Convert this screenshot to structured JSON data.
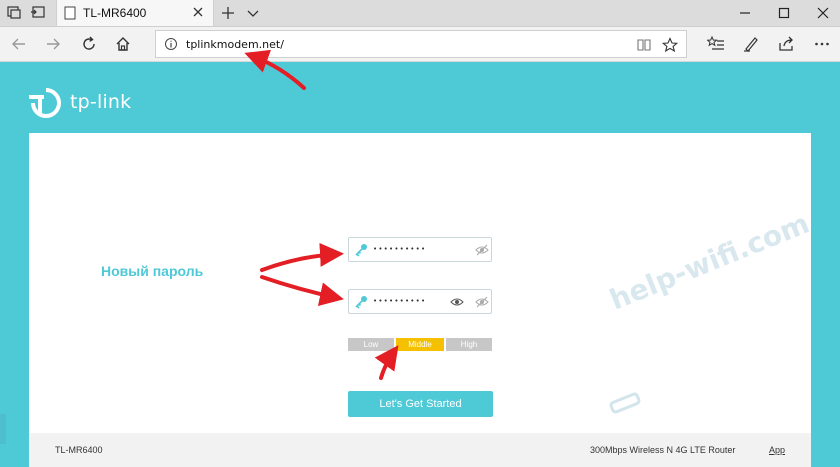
{
  "browser": {
    "tab_title": "TL-MR6400",
    "address_url": "tplinkmodem.net/"
  },
  "brand": {
    "logo_text": "tp-link",
    "accent_color": "#4ec9d6",
    "strength_active_color": "#f5c000"
  },
  "form": {
    "password_dots": "••••••••••",
    "confirm_dots": "••••••••••",
    "strength": {
      "low": "Low",
      "middle": "Middle",
      "high": "High",
      "selected": "middle"
    },
    "start_button": "Let's Get Started"
  },
  "annotation": {
    "label": "Новый пароль"
  },
  "footer": {
    "model": "TL-MR6400",
    "description": "300Mbps Wireless N 4G LTE Router",
    "app_link": "App"
  },
  "watermark": {
    "text": "help-wifi.com"
  },
  "icons": {
    "tab_preview": "tab-preview-icon",
    "tab_back": "set-aside-tabs-icon",
    "page_icon": "page-icon",
    "close": "close-icon",
    "new_tab": "plus-icon",
    "tab_menu": "chevron-down-icon",
    "minimize": "minimize-icon",
    "maximize": "maximize-icon",
    "window_close": "window-close-icon",
    "back": "arrow-left-icon",
    "forward": "arrow-right-icon",
    "refresh": "refresh-icon",
    "home": "home-icon",
    "info": "info-icon",
    "reading_view": "book-icon",
    "favorite": "star-icon",
    "favorites_list": "favorites-list-icon",
    "notes": "pen-icon",
    "share": "share-icon",
    "more": "more-icon",
    "key": "key-icon",
    "eye": "eye-icon",
    "eye_off": "eye-off-icon"
  }
}
